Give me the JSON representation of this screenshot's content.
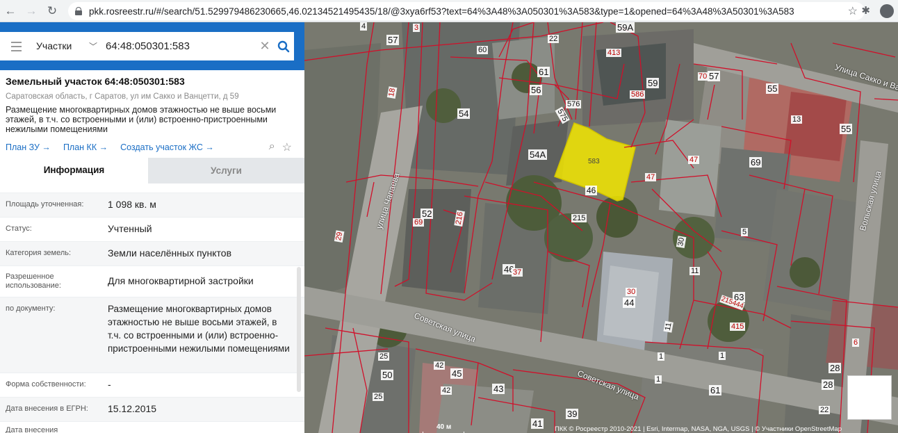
{
  "browser": {
    "url": "pkk.rosreestr.ru/#/search/51.529979486230665,46.02134521495435/18/@3xya6rf53?text=64%3A48%3A050301%3A583&type=1&opened=64%3A48%3A50301%3A583"
  },
  "search": {
    "type_label": "Участки",
    "value": "64:48:050301:583"
  },
  "parcel": {
    "title": "Земельный участок 64:48:050301:583",
    "address": "Саратовская область, г Саратов, ул им Сакко и Ванцетти, д 59",
    "description": "Размещение многоквартирных домов этажностью не выше восьми этажей, в т.ч. со встроенными и (или) встроенно-пристроенными нежилыми помещениями"
  },
  "links": {
    "plan_zu": "План ЗУ →",
    "plan_kk": "План КК →",
    "create_zhs": "Создать участок ЖС →"
  },
  "tabs": {
    "info": "Информация",
    "services": "Услуги"
  },
  "rows": {
    "area_label": "Площадь уточненная:",
    "area_value": "1 098 кв. м",
    "status_label": "Статус:",
    "status_value": "Учтенный",
    "category_label": "Категория земель:",
    "category_value": "Земли населённых пунктов",
    "use_label": "Разрешенное использование:",
    "use_value": "Для многоквартирной застройки",
    "doc_label": "по документу:",
    "doc_value": "Размещение многоквартирных домов этажностью не выше восьми этажей, в т.ч. со встроенными и (или) встроенно-пристроенными нежилыми помещениями",
    "ownership_label": "Форма собственности:",
    "ownership_value": "-",
    "egrn_label": "Дата внесения в ЕГРН:",
    "egrn_value": "15.12.2015",
    "more_label": "Дата внесения"
  },
  "map": {
    "scale": "40 м",
    "attribution": "ПКК © Росреестр 2010-2021 | Esri, Intermap, NASA, NGA, USGS | © Участники OpenStreetMap",
    "streets": {
      "chapaeva": "улица Чапаева",
      "sovetskaya1": "Советская улица",
      "sovetskaya2": "Советская улица",
      "sakko": "Улица Сакко и Ванцетти",
      "volskaya": "Вольская улица"
    },
    "labels": {
      "l583": "583",
      "l46a": "46",
      "l54a": "54А",
      "l54": "54",
      "l61": "61",
      "l56": "56",
      "l59": "59",
      "l59a": "59А",
      "l413": "413",
      "l586": "586",
      "l576": "576",
      "l575": "575",
      "l57a": "57",
      "l70": "70",
      "l57b": "57",
      "l55a": "55",
      "l55b": "55",
      "l13": "13",
      "l47a": "47",
      "l47b": "47",
      "l69a": "69",
      "l60": "60",
      "l22": "22",
      "l18": "18",
      "l29": "29",
      "l52": "52",
      "l69b": "69",
      "l216": "216",
      "l215": "215",
      "l46b": "46",
      "l37": "37",
      "l30a": "30",
      "l44": "44",
      "l30b": "30",
      "l11a": "11",
      "l11b": "11",
      "l5": "5",
      "l63": "63",
      "l215444": "215444",
      "l415": "415",
      "l6": "6",
      "l28a": "28",
      "l28b": "28",
      "l22b": "22",
      "l1a": "1",
      "l1b": "1",
      "l1c": "1",
      "l61b": "61",
      "l25a": "25",
      "l25b": "25",
      "l50": "50",
      "l42a": "42",
      "l42b": "42",
      "l45": "45",
      "l43": "43",
      "l39": "39",
      "l41": "41",
      "l4": "4",
      "l3": "3"
    }
  }
}
